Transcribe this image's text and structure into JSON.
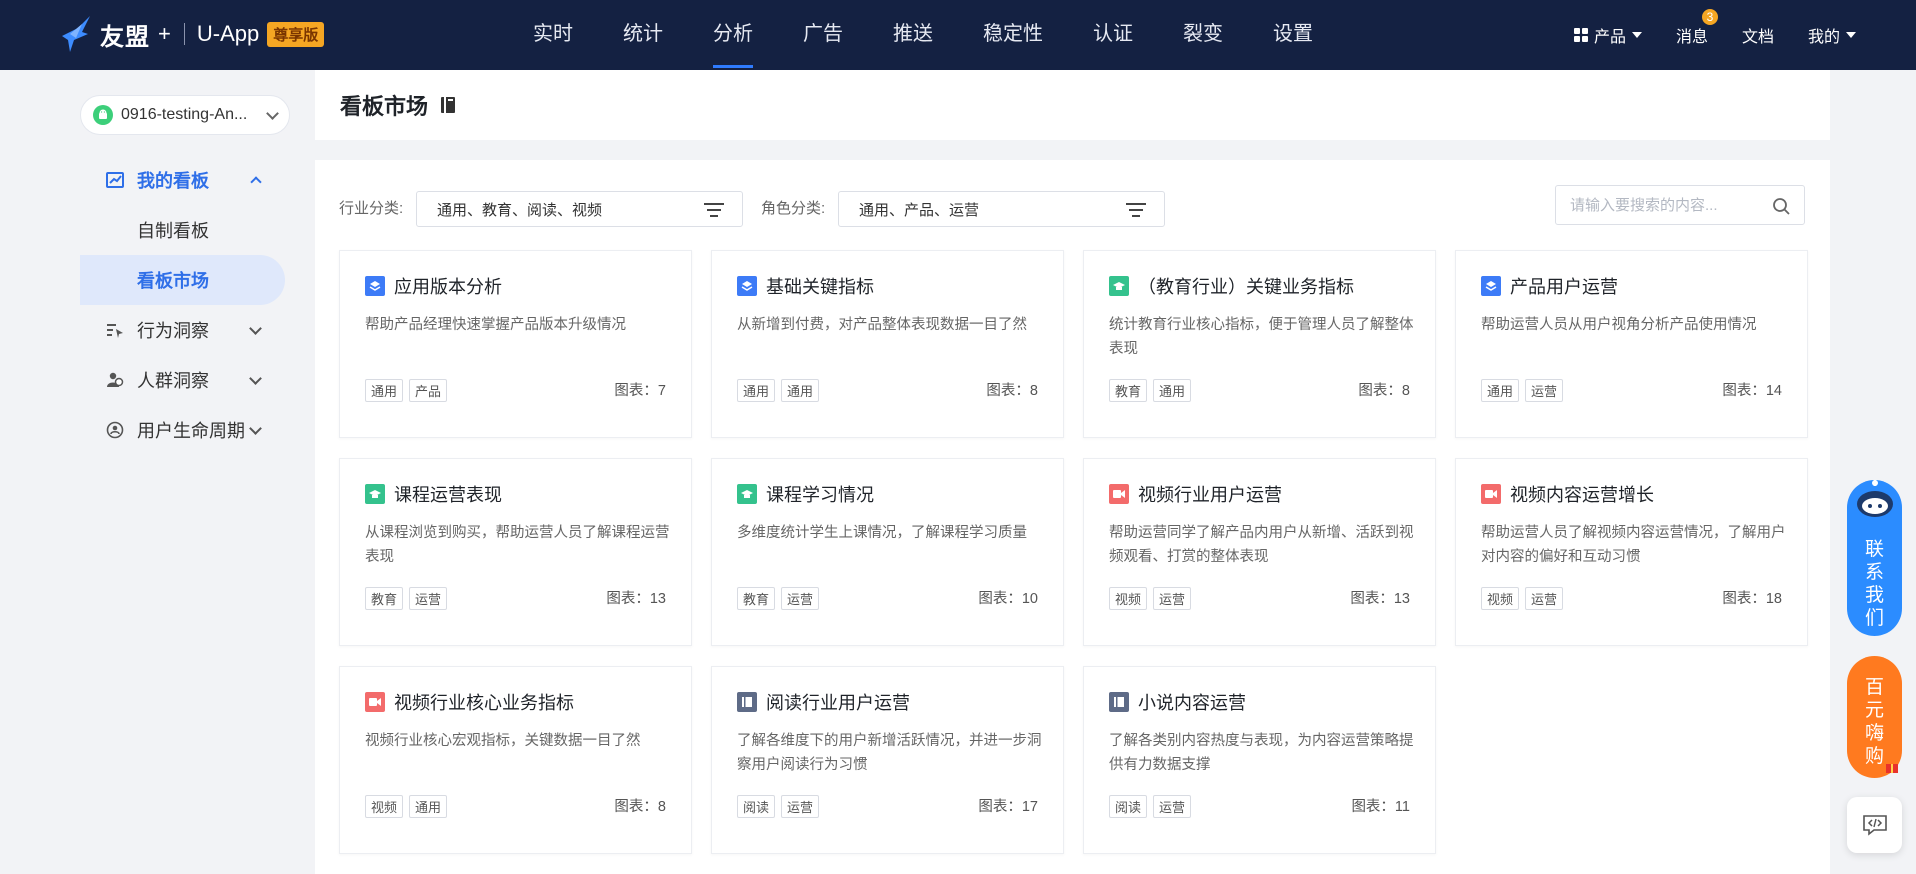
{
  "brand": {
    "name": "友盟",
    "plus": "+",
    "app": "U-App",
    "edition": "尊享版"
  },
  "nav": {
    "items": [
      {
        "label": "实时"
      },
      {
        "label": "统计"
      },
      {
        "label": "分析"
      },
      {
        "label": "广告"
      },
      {
        "label": "推送"
      },
      {
        "label": "稳定性"
      },
      {
        "label": "认证"
      },
      {
        "label": "裂变"
      },
      {
        "label": "设置"
      }
    ],
    "active": "分析"
  },
  "top_right": {
    "product": "产品",
    "messages": "消息",
    "message_count": "3",
    "docs": "文档",
    "mine": "我的"
  },
  "app_selector": {
    "label": "0916-testing-An..."
  },
  "sidebar": {
    "my_boards": "我的看板",
    "custom_board": "自制看板",
    "board_market": "看板市场",
    "behavior": "行为洞察",
    "crowd": "人群洞察",
    "lifecycle": "用户生命周期"
  },
  "page": {
    "title": "看板市场"
  },
  "filters": {
    "industry_label": "行业分类:",
    "industry_value": "通用、教育、阅读、视频",
    "role_label": "角色分类:",
    "role_value": "通用、产品、运营",
    "search_placeholder": "请输入要搜索的内容..."
  },
  "cards": [
    {
      "title": "应用版本分析",
      "desc": "帮助产品经理快速掌握产品版本升级情况",
      "tags": [
        "通用",
        "产品"
      ],
      "count": "图表：7",
      "icon": "layers-icon",
      "color": "blue"
    },
    {
      "title": "基础关键指标",
      "desc": "从新增到付费，对产品整体表现数据一目了然",
      "tags": [
        "通用",
        "通用"
      ],
      "count": "图表：8",
      "icon": "layers-icon",
      "color": "blue"
    },
    {
      "title": "（教育行业）关键业务指标",
      "desc": "统计教育行业核心指标，便于管理人员了解整体表现",
      "tags": [
        "教育",
        "通用"
      ],
      "count": "图表：8",
      "icon": "graduation-cap-icon",
      "color": "green"
    },
    {
      "title": "产品用户运营",
      "desc": "帮助运营人员从用户视角分析产品使用情况",
      "tags": [
        "通用",
        "运营"
      ],
      "count": "图表：14",
      "icon": "layers-icon",
      "color": "blue"
    },
    {
      "title": "课程运营表现",
      "desc": "从课程浏览到购买，帮助运营人员了解课程运营表现",
      "tags": [
        "教育",
        "运营"
      ],
      "count": "图表：13",
      "icon": "graduation-cap-icon",
      "color": "green"
    },
    {
      "title": "课程学习情况",
      "desc": "多维度统计学生上课情况，了解课程学习质量",
      "tags": [
        "教育",
        "运营"
      ],
      "count": "图表：10",
      "icon": "graduation-cap-icon",
      "color": "green"
    },
    {
      "title": "视频行业用户运营",
      "desc": "帮助运营同学了解产品内用户从新增、活跃到视频观看、打赏的整体表现",
      "tags": [
        "视频",
        "运营"
      ],
      "count": "图表：13",
      "icon": "video-camera-icon",
      "color": "red"
    },
    {
      "title": "视频内容运营增长",
      "desc": "帮助运营人员了解视频内容运营情况，了解用户对内容的偏好和互动习惯",
      "tags": [
        "视频",
        "运营"
      ],
      "count": "图表：18",
      "icon": "video-camera-icon",
      "color": "red"
    },
    {
      "title": "视频行业核心业务指标",
      "desc": "视频行业核心宏观指标，关键数据一目了然",
      "tags": [
        "视频",
        "通用"
      ],
      "count": "图表：8",
      "icon": "video-camera-icon",
      "color": "red"
    },
    {
      "title": "阅读行业用户运营",
      "desc": "了解各维度下的用户新增活跃情况，并进一步洞察用户阅读行为习惯",
      "tags": [
        "阅读",
        "运营"
      ],
      "count": "图表：17",
      "icon": "book-icon",
      "color": "slate"
    },
    {
      "title": "小说内容运营",
      "desc": "了解各类别内容热度与表现，为内容运营策略提供有力数据支撑",
      "tags": [
        "阅读",
        "运营"
      ],
      "count": "图表：11",
      "icon": "book-icon",
      "color": "slate"
    }
  ],
  "floating": {
    "contact": "联系我们",
    "deal": "百元嗨购"
  },
  "colors": {
    "topbar": "#142142",
    "accent": "#2f6fe8",
    "active_bg": "#dfe8fb"
  }
}
